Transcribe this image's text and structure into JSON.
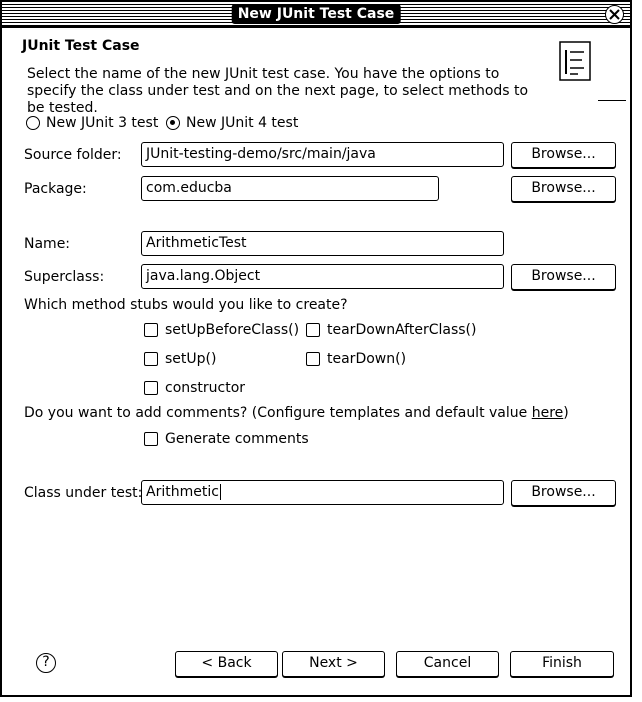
{
  "window": {
    "title": "New JUnit Test Case"
  },
  "header": {
    "title": "JUnit Test Case",
    "description": "Select the name of the new JUnit test case. You have the options to specify the class under test and on the next page, to select methods to be tested."
  },
  "version": {
    "junit3_label": "New JUnit 3 test",
    "junit4_label": "New JUnit 4 test",
    "selected": "junit4"
  },
  "source_folder": {
    "label": "Source folder:",
    "value": "JUnit-testing-demo/src/main/java",
    "browse": "Browse..."
  },
  "package": {
    "label": "Package:",
    "value": "com.educba",
    "browse": "Browse..."
  },
  "name": {
    "label": "Name:",
    "value": "ArithmeticTest"
  },
  "superclass": {
    "label": "Superclass:",
    "value": "java.lang.Object",
    "browse": "Browse..."
  },
  "stubs": {
    "question": "Which method stubs would you like to create?",
    "setup_before_class": "setUpBeforeClass()",
    "teardown_after_class": "tearDownAfterClass()",
    "setup": "setUp()",
    "teardown": "tearDown()",
    "constructor": "constructor"
  },
  "comments": {
    "question_prefix": "Do you want to add comments? (Configure templates and default value ",
    "link": "here",
    "question_suffix": ")",
    "generate": "Generate comments"
  },
  "class_under_test": {
    "label": "Class under test:",
    "value": "Arithmetic",
    "browse": "Browse..."
  },
  "footer": {
    "back": "< Back",
    "next": "Next >",
    "cancel": "Cancel",
    "finish": "Finish",
    "help": "?"
  }
}
